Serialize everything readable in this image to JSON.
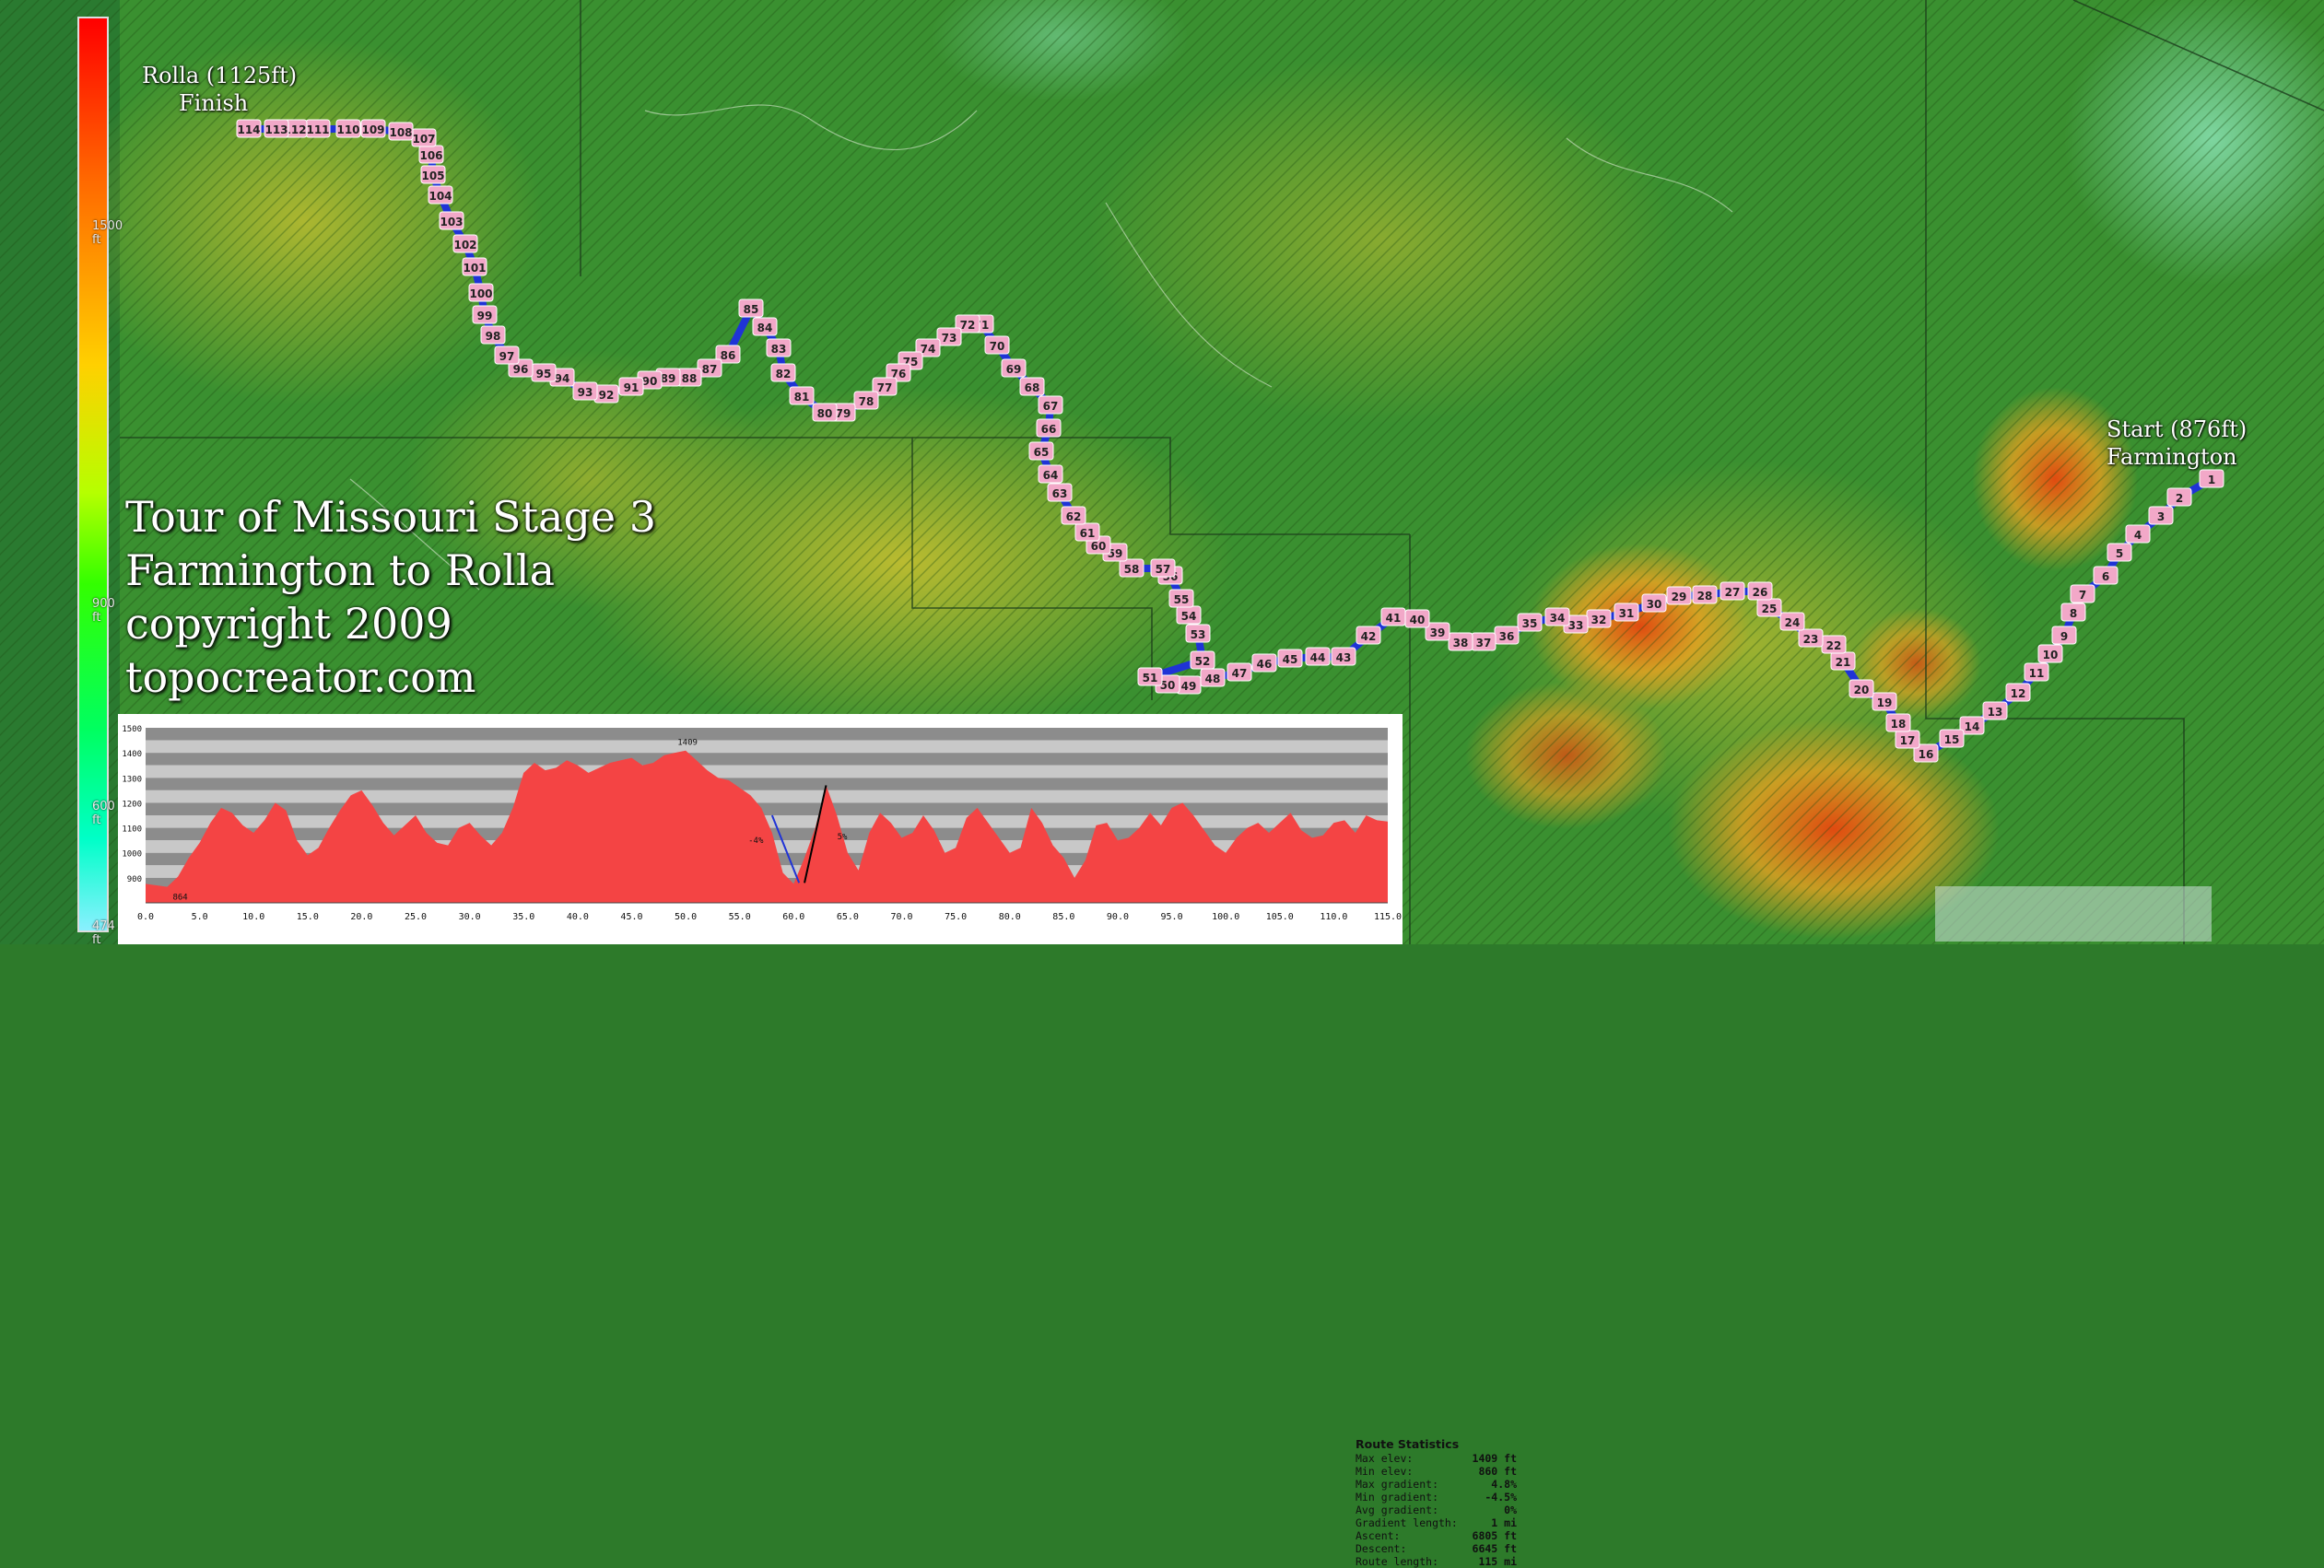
{
  "title": {
    "line1": "Tour of Missouri Stage 3",
    "line2": "Farmington to Rolla",
    "line3": "copyright 2009",
    "line4": "topocreator.com"
  },
  "labels": {
    "finish_elev": "Rolla (1125ft)",
    "finish": "Finish",
    "start_elev": "Start (876ft)",
    "start_town": "Farmington"
  },
  "legend": {
    "ticks": [
      "1500 ft",
      "900 ft",
      "600 ft",
      "474 ft"
    ]
  },
  "route": {
    "color": "#1f33d6",
    "marker_fill": "#f2a8c8",
    "markers_miles": [
      1,
      2,
      3,
      4,
      5,
      6,
      7,
      8,
      9,
      10,
      11,
      12,
      13,
      14,
      15,
      16,
      17,
      18,
      19,
      20,
      21,
      22,
      23,
      24,
      25,
      26,
      27,
      28,
      29,
      30,
      31,
      32,
      33,
      34,
      35,
      36,
      37,
      38,
      39,
      40,
      41,
      42,
      43,
      44,
      45,
      46,
      47,
      48,
      49,
      50,
      51,
      52,
      53,
      54,
      55,
      56,
      57,
      58,
      59,
      60,
      61,
      62,
      63,
      64,
      65,
      66,
      67,
      68,
      69,
      70,
      71,
      72,
      73,
      74,
      75,
      76,
      77,
      78,
      79,
      80,
      81,
      82,
      83,
      84,
      85,
      86,
      87,
      88,
      89,
      90,
      91,
      92,
      93,
      94,
      95,
      96,
      97,
      98,
      99,
      100,
      101,
      102,
      103,
      104,
      105,
      106,
      107,
      108,
      109,
      110,
      111,
      112,
      113,
      114
    ]
  },
  "stats": {
    "heading": "Route Statistics",
    "rows": [
      {
        "label": "Max elev:",
        "value": "1409 ft"
      },
      {
        "label": "Min elev:",
        "value": "860 ft"
      },
      {
        "label": "Max gradient:",
        "value": "4.8%"
      },
      {
        "label": "Min gradient:",
        "value": "-4.5%"
      },
      {
        "label": "Avg gradient:",
        "value": "0%"
      },
      {
        "label": "Gradient length:",
        "value": "1 mi"
      },
      {
        "label": "Ascent:",
        "value": "6805 ft"
      },
      {
        "label": "Descent:",
        "value": "6645 ft"
      },
      {
        "label": "Route length:",
        "value": "115 mi"
      }
    ]
  },
  "chart_data": {
    "type": "area",
    "fill_color": "#f44444",
    "xlim": [
      0,
      115
    ],
    "ylim": [
      800,
      1500
    ],
    "x_ticks": [
      "0.0",
      "5.0",
      "10.0",
      "15.0",
      "20.0",
      "25.0",
      "30.0",
      "35.0",
      "40.0",
      "45.0",
      "50.0",
      "55.0",
      "60.0",
      "65.0",
      "70.0",
      "75.0",
      "80.0",
      "85.0",
      "90.0",
      "95.0",
      "100.0",
      "105.0",
      "110.0",
      "115.0"
    ],
    "y_ticks": [
      "900",
      "1000",
      "1100",
      "1200",
      "1300",
      "1400",
      "1500"
    ],
    "annotations": {
      "max_label": "1409",
      "min_label": "864",
      "grad_neg": "-4%",
      "grad_pos": "5%"
    },
    "x": [
      0,
      1,
      2,
      3,
      4,
      5,
      6,
      7,
      8,
      9,
      10,
      11,
      12,
      13,
      14,
      15,
      16,
      17,
      18,
      19,
      20,
      21,
      22,
      23,
      24,
      25,
      26,
      27,
      28,
      29,
      30,
      31,
      32,
      33,
      34,
      35,
      36,
      37,
      38,
      39,
      40,
      41,
      42,
      43,
      44,
      45,
      46,
      47,
      48,
      49,
      50,
      51,
      52,
      53,
      54,
      55,
      56,
      57,
      58,
      59,
      60,
      61,
      62,
      63,
      64,
      65,
      66,
      67,
      68,
      69,
      70,
      71,
      72,
      73,
      74,
      75,
      76,
      77,
      78,
      79,
      80,
      81,
      82,
      83,
      84,
      85,
      86,
      87,
      88,
      89,
      90,
      91,
      92,
      93,
      94,
      95,
      96,
      97,
      98,
      99,
      100,
      101,
      102,
      103,
      104,
      105,
      106,
      107,
      108,
      109,
      110,
      111,
      112,
      113,
      114,
      115
    ],
    "y": [
      876,
      870,
      864,
      905,
      980,
      1040,
      1120,
      1180,
      1160,
      1110,
      1080,
      1130,
      1200,
      1170,
      1050,
      990,
      1020,
      1100,
      1170,
      1230,
      1250,
      1190,
      1120,
      1070,
      1110,
      1150,
      1080,
      1040,
      1030,
      1100,
      1120,
      1070,
      1030,
      1080,
      1180,
      1320,
      1360,
      1330,
      1340,
      1370,
      1350,
      1320,
      1340,
      1360,
      1370,
      1380,
      1350,
      1360,
      1390,
      1400,
      1409,
      1370,
      1330,
      1300,
      1290,
      1260,
      1230,
      1180,
      1080,
      920,
      876,
      980,
      1100,
      1270,
      1150,
      1000,
      930,
      1080,
      1160,
      1120,
      1060,
      1080,
      1150,
      1090,
      1000,
      1020,
      1140,
      1180,
      1120,
      1060,
      1000,
      1020,
      1180,
      1120,
      1030,
      980,
      900,
      970,
      1110,
      1120,
      1050,
      1060,
      1100,
      1160,
      1110,
      1180,
      1200,
      1150,
      1090,
      1030,
      1000,
      1060,
      1100,
      1120,
      1080,
      1120,
      1160,
      1090,
      1060,
      1070,
      1120,
      1130,
      1080,
      1150,
      1130,
      1125
    ]
  }
}
